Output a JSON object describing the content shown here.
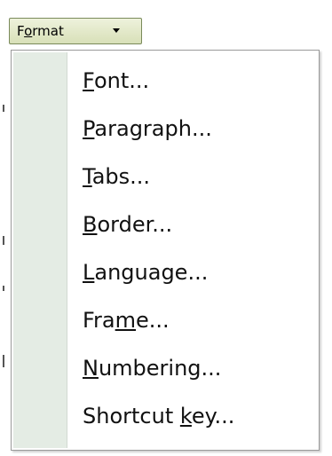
{
  "format_button": {
    "label": "Format",
    "mnemonic_index": 1
  },
  "menu": {
    "items": [
      {
        "label": "Font...",
        "mnemonic": "F",
        "pre": "",
        "post": "ont..."
      },
      {
        "label": "Paragraph...",
        "mnemonic": "P",
        "pre": "",
        "post": "aragraph..."
      },
      {
        "label": "Tabs...",
        "mnemonic": "T",
        "pre": "",
        "post": "abs..."
      },
      {
        "label": "Border...",
        "mnemonic": "B",
        "pre": "",
        "post": "order..."
      },
      {
        "label": "Language...",
        "mnemonic": "L",
        "pre": "",
        "post": "anguage..."
      },
      {
        "label": "Frame...",
        "mnemonic": "m",
        "pre": "Fra",
        "post": "e..."
      },
      {
        "label": "Numbering...",
        "mnemonic": "N",
        "pre": "",
        "post": "umbering..."
      },
      {
        "label": "Shortcut key...",
        "mnemonic": "k",
        "pre": "Shortcut ",
        "post": "ey..."
      }
    ]
  },
  "colors": {
    "icon_strip": "#e4ece4",
    "button_bg": "#d8e0b8",
    "menu_border": "#9a9a9a"
  }
}
